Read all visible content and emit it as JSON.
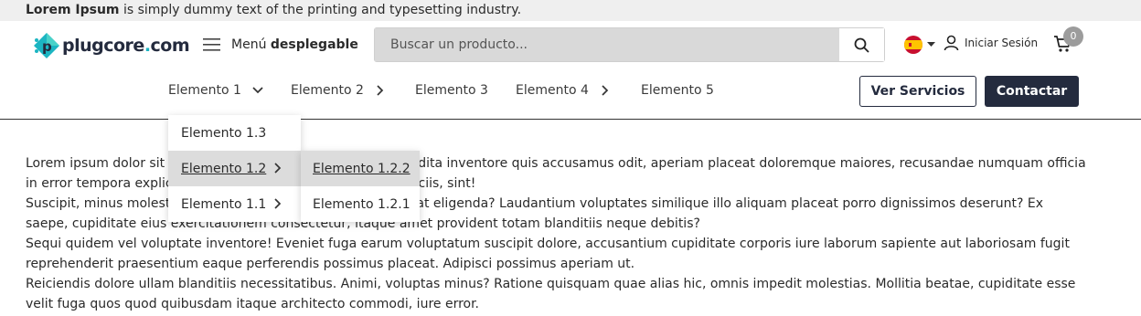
{
  "announcement": {
    "bold": "Lorem Ipsum",
    "rest": " is simply dummy text of the printing and typesetting industry."
  },
  "logo": {
    "name": "plugcore",
    "dot": ".",
    "tld": "com"
  },
  "menu": {
    "prefix": "Menú ",
    "bold": "desplegable"
  },
  "search": {
    "placeholder": "Buscar un producto..."
  },
  "login": {
    "label": "Iniciar Sesión"
  },
  "cart": {
    "count": "0"
  },
  "nav": {
    "items": [
      {
        "label": "Elemento 1"
      },
      {
        "label": "Elemento 2"
      },
      {
        "label": "Elemento 3"
      },
      {
        "label": "Elemento 4"
      },
      {
        "label": "Elemento 5"
      }
    ]
  },
  "buttons": {
    "services": "Ver Servicios",
    "contact": "Contactar"
  },
  "dropdown": {
    "items": [
      {
        "label": "Elemento 1.3"
      },
      {
        "label": "Elemento 1.2"
      },
      {
        "label": "Elemento 1.1"
      }
    ],
    "submenu": [
      {
        "label": "Elemento 1.2.2"
      },
      {
        "label": "Elemento 1.2.1"
      }
    ]
  },
  "content": {
    "paragraphs": [
      "Lorem ipsum dolor sit amet consectetur adipisicing elit. Expedita inventore quis accusamus odit, aperiam placeat doloremque maiores, recusandae numquam officia in error tempora explicabo molestias quidem quo rerum? Officiis, sint!",
      "Suscipit, minus molestias dolorem quas iste doloremque fugiat eligenda? Laudantium voluptates similique illo aliquam placeat porro dignissimos deserunt? Ex saepe, cupiditate eius exercitationem consectetur, itaque amet provident totam blanditiis neque debitis?",
      "Sequi quidem vel voluptate inventore! Eveniet fuga earum voluptatum suscipit dolore, accusantium cupiditate corporis iure laborum sapiente aut laboriosam fugit reprehenderit praesentium eaque perferendis possimus placeat. Adipisci possimus aperiam ut.",
      "Reiciendis dolore ullam blanditiis necessitatibus. Animi, voluptas minus? Ratione quisquam quae alias hic, omnis impedit molestias. Mollitia beatae, cupiditate esse velit fuga quos quod quibusdam itaque architecto commodi, iure error."
    ]
  },
  "colors": {
    "brand_dark": "#242b3e",
    "brand_teal": "#1cb5c2",
    "topbar_bg": "#efefef",
    "hover_bg": "#dcdcdc"
  }
}
